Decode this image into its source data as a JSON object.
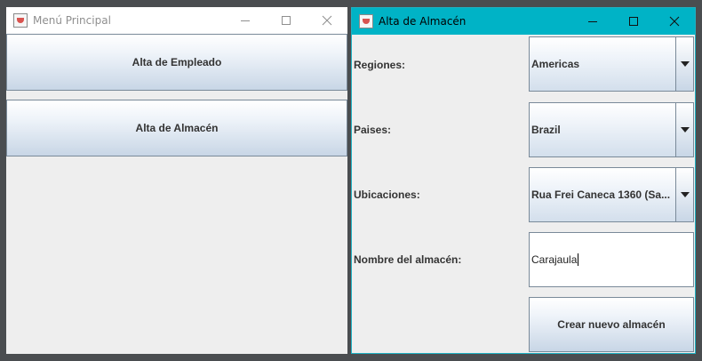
{
  "windows": {
    "menu": {
      "title": "Menú Principal",
      "buttons": {
        "alta_empleado": "Alta de Empleado",
        "alta_almacen": "Alta de Almacén"
      }
    },
    "alta": {
      "title": "Alta de Almacén",
      "fields": {
        "regiones": {
          "label": "Regiones:",
          "value": "Americas"
        },
        "paises": {
          "label": "Paises:",
          "value": "Brazil"
        },
        "ubicaciones": {
          "label": "Ubicaciones:",
          "value": "Rua Frei Caneca 1360  (Sa..."
        },
        "nombre": {
          "label": "Nombre del almacén:",
          "value": "Carajaula"
        }
      },
      "create_button": "Crear nuevo almacén"
    }
  },
  "colors": {
    "active_titlebar": "#00b3c6",
    "inactive_titlebar": "#ffffff",
    "desktop": "#4a4d50"
  },
  "icons": {
    "app": "java-cup-icon",
    "minimize": "minimize-icon",
    "maximize": "maximize-icon",
    "close": "close-icon",
    "dropdown": "chevron-down-icon"
  }
}
